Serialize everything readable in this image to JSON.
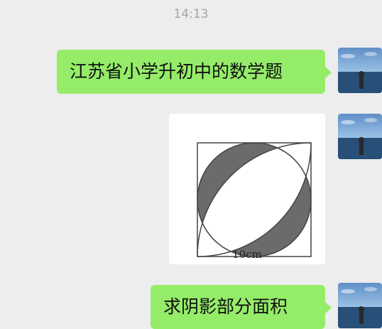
{
  "chat": {
    "timestamp": "14:13",
    "messages": [
      {
        "type": "text",
        "text": "江苏省小学升初中的数学题"
      },
      {
        "type": "image",
        "image": {
          "dimension_label": "10cm"
        }
      },
      {
        "type": "text",
        "text": "求阴影部分面积"
      }
    ]
  },
  "colors": {
    "background": "#ededed",
    "bubble": "#95ec69",
    "timestamp": "#a6a6a6"
  }
}
